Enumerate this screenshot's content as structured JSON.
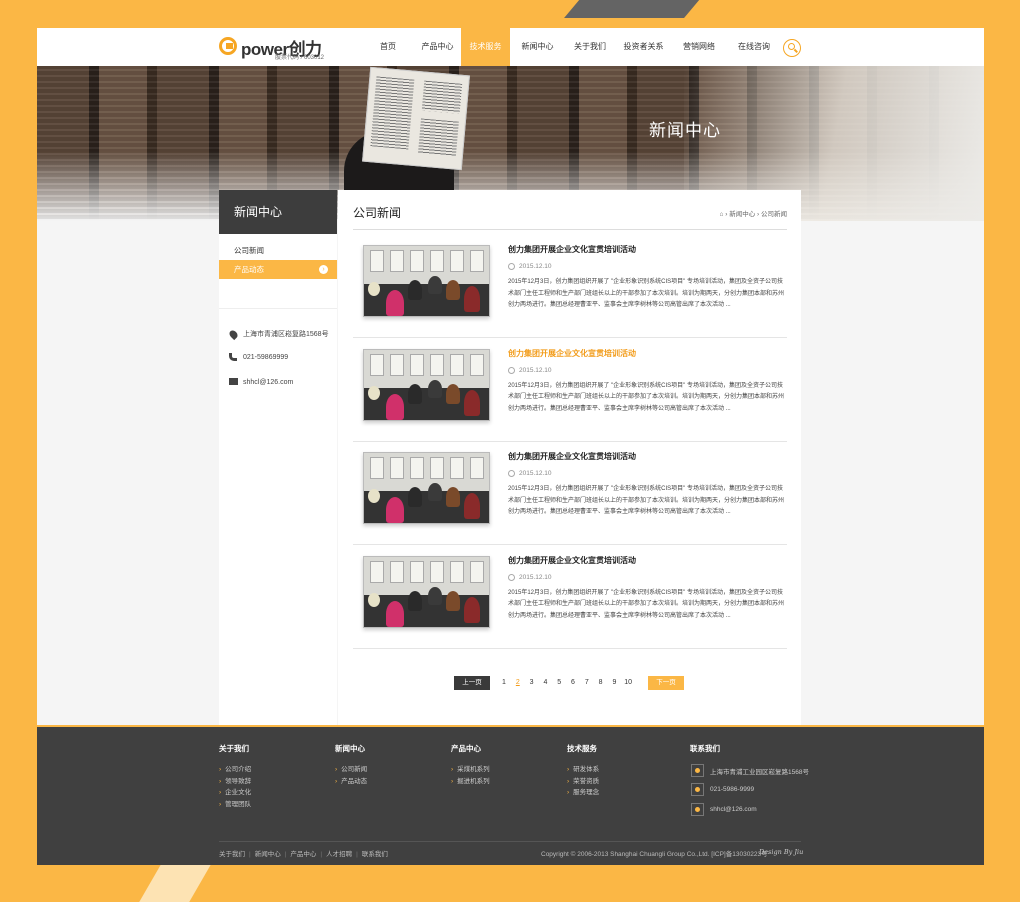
{
  "brand": {
    "logo_text": "power",
    "logo_cn": "创力",
    "stock_code": "股票代码 / 603012"
  },
  "nav": {
    "items": [
      {
        "label": "首页",
        "w": 52
      },
      {
        "label": "产品中心",
        "w": 47
      },
      {
        "label": "技术服务",
        "w": 49
      },
      {
        "label": "新闻中心",
        "w": 55
      },
      {
        "label": "关于我们",
        "w": 50
      },
      {
        "label": "投资者关系",
        "w": 57
      },
      {
        "label": "营销网络",
        "w": 54
      },
      {
        "label": "在线咨询",
        "w": 56
      }
    ],
    "active_index": 2
  },
  "banner": {
    "title": "新闻中心"
  },
  "sidebar": {
    "title": "新闻中心",
    "items": [
      {
        "label": "公司新闻"
      },
      {
        "label": "产品动态"
      }
    ],
    "active_index": 1,
    "address": "上海市青浦区崧复路1568号",
    "phone": "021-59869999",
    "email": "shhcl@126.com"
  },
  "main": {
    "title": "公司新闻",
    "breadcrumb": {
      "home_icon": "home-icon",
      "level1": "新闻中心",
      "level2": "公司新闻"
    },
    "posts": [
      {
        "title": "创力集团开展企业文化宣贯培训活动",
        "date": "2015.12.10",
        "excerpt": "2015年12月3日，创力集团组织开展了 \"企业形象识别系统CIS项目\" 专场培训活动，集团及全资子公司技术部门主任工程师和生产部门班组长以上的干部参加了本次培训。培训为期两天，分创力集团本部和苏州创力两场进行。集团总经理曹亚平、监事会主席李树林等公司高管出席了本次活动 ...",
        "highlight": false
      },
      {
        "title": "创力集团开展企业文化宣贯培训活动",
        "date": "2015.12.10",
        "excerpt": "2015年12月3日，创力集团组织开展了 \"企业形象识别系统CIS项目\" 专场培训活动，集团及全资子公司技术部门主任工程师和生产部门班组长以上的干部参加了本次培训。培训为期两天，分创力集团本部和苏州创力两场进行。集团总经理曹亚平、监事会主席李树林等公司高管出席了本次活动 ...",
        "highlight": true
      },
      {
        "title": "创力集团开展企业文化宣贯培训活动",
        "date": "2015.12.10",
        "excerpt": "2015年12月3日，创力集团组织开展了 \"企业形象识别系统CIS项目\" 专场培训活动，集团及全资子公司技术部门主任工程师和生产部门班组长以上的干部参加了本次培训。培训为期两天，分创力集团本部和苏州创力两场进行。集团总经理曹亚平、监事会主席李树林等公司高管出席了本次活动 ...",
        "highlight": false
      },
      {
        "title": "创力集团开展企业文化宣贯培训活动",
        "date": "2015.12.10",
        "excerpt": "2015年12月3日，创力集团组织开展了 \"企业形象识别系统CIS项目\" 专场培训活动，集团及全资子公司技术部门主任工程师和生产部门班组长以上的干部参加了本次培训。培训为期两天，分创力集团本部和苏州创力两场进行。集团总经理曹亚平、监事会主席李树林等公司高管出席了本次活动 ...",
        "highlight": false
      }
    ]
  },
  "pager": {
    "prev": "上一页",
    "next": "下一页",
    "pages": [
      "1",
      "2",
      "3",
      "4",
      "5",
      "6",
      "7",
      "8",
      "9",
      "10"
    ],
    "current": "2"
  },
  "footer": {
    "columns": [
      {
        "title": "关于我们",
        "items": [
          "公司介绍",
          "领导致辞",
          "企业文化",
          "管理团队"
        ]
      },
      {
        "title": "新闻中心",
        "items": [
          "公司新闻",
          "产品动态"
        ]
      },
      {
        "title": "产品中心",
        "items": [
          "采煤机系列",
          "掘进机系列"
        ]
      },
      {
        "title": "技术服务",
        "items": [
          "研发体系",
          "荣誉资质",
          "服务理念"
        ]
      }
    ],
    "contact_title": "联系我们",
    "contact": {
      "address": "上海市青浦工业园区崧复路1568号",
      "phone": "021-5986-9999",
      "email": "shhcl@126.com"
    },
    "bottom_links": [
      "关于我们",
      "新闻中心",
      "产品中心",
      "人才招聘",
      "联系我们"
    ],
    "copyright": "Copyright © 2006-2013 Shanghai Chuangli Group Co.,Ltd. [ICP]备13030223号",
    "design": "Design By Jiu"
  },
  "colors": {
    "accent": "#fbb745",
    "dark": "#404040",
    "highlight": "#f29b18"
  }
}
